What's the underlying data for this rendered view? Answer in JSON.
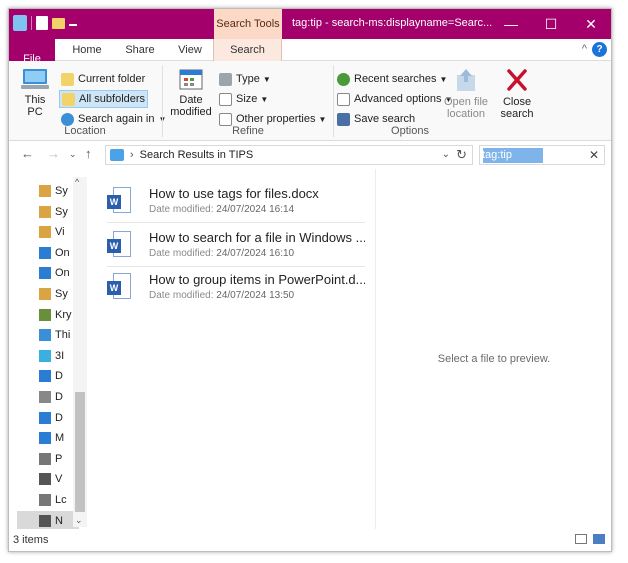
{
  "window": {
    "title": "tag:tip - search-ms:displayname=Searc...",
    "contextual_tab_group": "Search Tools",
    "controls": {
      "minimize": "—",
      "maximize": "☐",
      "close": "✕"
    }
  },
  "ribbon_tabs": {
    "file": "File",
    "home": "Home",
    "share": "Share",
    "view": "View",
    "search": "Search",
    "collapse": "^",
    "help": "?"
  },
  "ribbon": {
    "location": {
      "label": "Location",
      "this_pc": [
        "This",
        "PC"
      ],
      "current_folder": "Current folder",
      "all_subfolders": "All subfolders",
      "search_again_in": "Search again in"
    },
    "refine": {
      "label": "Refine",
      "date_modified": [
        "Date",
        "modified"
      ],
      "type": "Type",
      "size": "Size",
      "other_properties": "Other properties"
    },
    "options": {
      "label": "Options",
      "recent_searches": "Recent searches",
      "advanced_options": "Advanced options",
      "save_search": "Save search",
      "open_file_location": [
        "Open file",
        "location"
      ],
      "close_search": [
        "Close",
        "search"
      ]
    }
  },
  "address": {
    "path": "Search Results in TIPS",
    "search_value": "tag:tip"
  },
  "nav": {
    "items": [
      "Sy",
      "Sy",
      "Vi",
      "On",
      "On",
      "Sy",
      "Kry",
      "Thi",
      "3I",
      "D",
      "D",
      "D",
      "M",
      "P",
      "V",
      "Lc",
      "N"
    ],
    "item_colors": [
      "#d9a441",
      "#d9a441",
      "#d9a441",
      "#2b7cd3",
      "#2b7cd3",
      "#d9a441",
      "#6a8f3a",
      "#3a8fd6",
      "#3ab0e0",
      "#2b7cd3",
      "#888888",
      "#2b7cd3",
      "#2b7cd3",
      "#777777",
      "#555555",
      "#777777",
      "#555555"
    ]
  },
  "files": [
    {
      "name": "How to use tags for files.docx",
      "meta_label": "Date modified:",
      "meta_value": "24/07/2024 16:14"
    },
    {
      "name": "How to search for a file in Windows ...",
      "meta_label": "Date modified:",
      "meta_value": "24/07/2024 16:10"
    },
    {
      "name": "How to group items in PowerPoint.d...",
      "meta_label": "Date modified:",
      "meta_value": "24/07/2024 13:50"
    }
  ],
  "preview": {
    "message": "Select a file to preview."
  },
  "status": {
    "item_count": "3 items"
  },
  "colors": {
    "accent": "#a3006c",
    "search_tools_tab": "#fbd9c6",
    "selection": "#cde5f7",
    "word_blue": "#2b5fad"
  }
}
